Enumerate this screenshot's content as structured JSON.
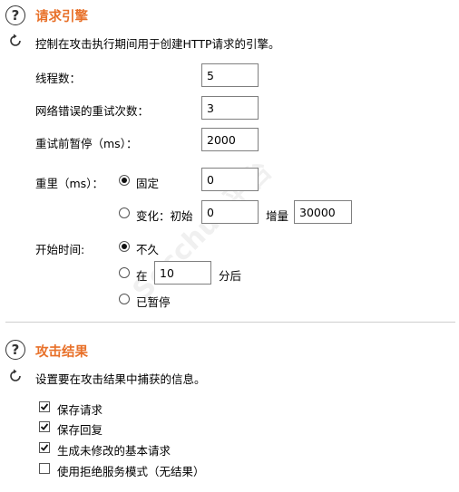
{
  "request_engine": {
    "title": "请求引擎",
    "description": "控制在攻击执行期间用于创建HTTP请求的引擎。",
    "threads_label": "线程数：",
    "threads_value": "5",
    "retries_label": "网络错误的重试次数：",
    "retries_value": "3",
    "pause_label": "重试前暂停（ms）：",
    "pause_value": "2000",
    "throttle_label": "重里（ms）：",
    "throttle_fixed_label": "固定",
    "throttle_fixed_value": "0",
    "throttle_variable_label": "变化：初始",
    "throttle_variable_start": "0",
    "throttle_increment_label": "增量",
    "throttle_increment_value": "30000",
    "start_time_label": "开始时间:",
    "start_immediately_label": "不久",
    "start_in_label": "在",
    "start_in_value": "10",
    "start_in_unit": "分后",
    "start_paused_label": "已暂停"
  },
  "attack_results": {
    "title": "攻击结果",
    "description": "设置要在攻击结果中捕获的信息。",
    "options": [
      {
        "label": "保存请求",
        "checked": true
      },
      {
        "label": "保存回复",
        "checked": true
      },
      {
        "label": "生成未修改的基本请求",
        "checked": true
      },
      {
        "label": "使用拒绝服务模式（无结果）",
        "checked": false
      }
    ]
  },
  "watermark": "Secchub平台"
}
